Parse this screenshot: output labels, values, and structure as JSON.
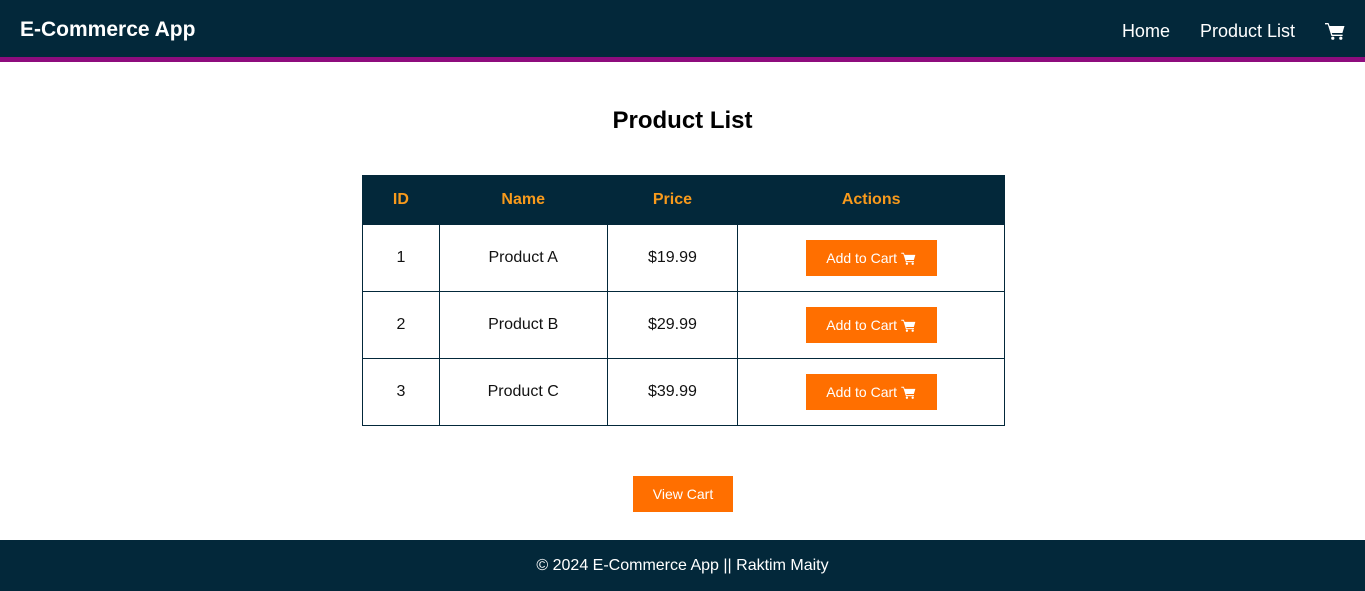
{
  "header": {
    "brand": "E-Commerce App",
    "nav": [
      "Home",
      "Product List"
    ],
    "cart_icon": "shopping-cart-icon"
  },
  "main": {
    "title": "Product List",
    "table": {
      "columns": [
        "ID",
        "Name",
        "Price",
        "Actions"
      ],
      "rows": [
        {
          "id": "1",
          "name": "Product A",
          "price": "$19.99",
          "action": "Add to Cart"
        },
        {
          "id": "2",
          "name": "Product B",
          "price": "$29.99",
          "action": "Add to Cart"
        },
        {
          "id": "3",
          "name": "Product C",
          "price": "$39.99",
          "action": "Add to Cart"
        }
      ]
    },
    "view_cart_label": "View Cart"
  },
  "footer": {
    "text": "© 2024 E-Commerce App || Raktim Maity"
  },
  "colors": {
    "navbar_bg": "#03283a",
    "navbar_border": "#8e0c7d",
    "table_header_text": "#f89a1c",
    "button_bg": "#ff6f00"
  }
}
